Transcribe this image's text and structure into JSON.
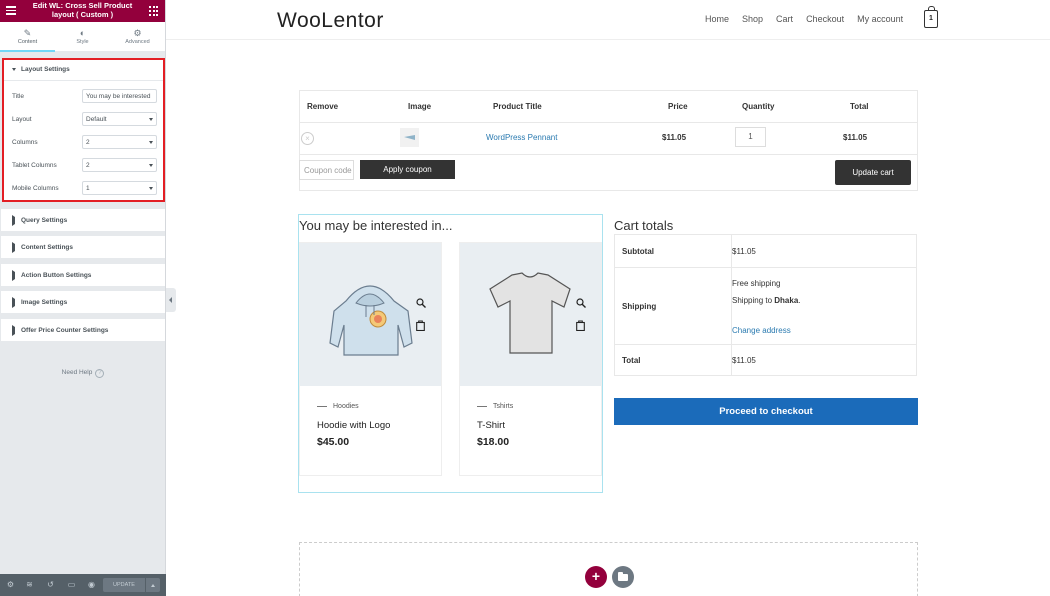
{
  "editor": {
    "header_title": "Edit WL: Cross Sell Product layout ( Custom )",
    "tabs": [
      {
        "label": "Content",
        "icon": "pencil-icon"
      },
      {
        "label": "Style",
        "icon": "contrast-icon"
      },
      {
        "label": "Advanced",
        "icon": "gear-icon"
      }
    ],
    "layout_section": {
      "title": "Layout Settings",
      "controls": [
        {
          "label": "Title",
          "value": "You may be interested"
        },
        {
          "label": "Layout",
          "value": "Default"
        },
        {
          "label": "Columns",
          "value": "2"
        },
        {
          "label": "Tablet Columns",
          "value": "2"
        },
        {
          "label": "Mobile Columns",
          "value": "1"
        }
      ]
    },
    "sections": [
      "Query Settings",
      "Content Settings",
      "Action Button Settings",
      "Image Settings",
      "Offer Price Counter Settings"
    ],
    "need_help": "Need Help",
    "update_label": "UPDATE",
    "accent_color": "#93003c"
  },
  "site": {
    "logo": "WooLentor",
    "nav": [
      "Home",
      "Shop",
      "Cart",
      "Checkout",
      "My account"
    ],
    "cart_count": "1"
  },
  "cart": {
    "headers": [
      "Remove",
      "Image",
      "Product Title",
      "Price",
      "Quantity",
      "Total"
    ],
    "row": {
      "product": "WordPress Pennant",
      "price": "$11.05",
      "quantity": "1",
      "total": "$11.05"
    },
    "coupon_placeholder": "Coupon code",
    "apply_coupon": "Apply coupon",
    "update_cart": "Update cart"
  },
  "cross_sells": {
    "title": "You may be interested in...",
    "products": [
      {
        "category": "Hoodies",
        "name": "Hoodie with Logo",
        "price": "$45.00"
      },
      {
        "category": "Tshirts",
        "name": "T-Shirt",
        "price": "$18.00"
      }
    ]
  },
  "totals": {
    "title": "Cart totals",
    "subtotal_label": "Subtotal",
    "subtotal_value": "$11.05",
    "shipping_label": "Shipping",
    "shipping_method": "Free shipping",
    "shipping_to_prefix": "Shipping to ",
    "shipping_to_city": "Dhaka",
    "change_address": "Change address",
    "total_label": "Total",
    "total_value": "$11.05",
    "checkout_button": "Proceed to checkout",
    "checkout_color": "#1b6bba"
  }
}
